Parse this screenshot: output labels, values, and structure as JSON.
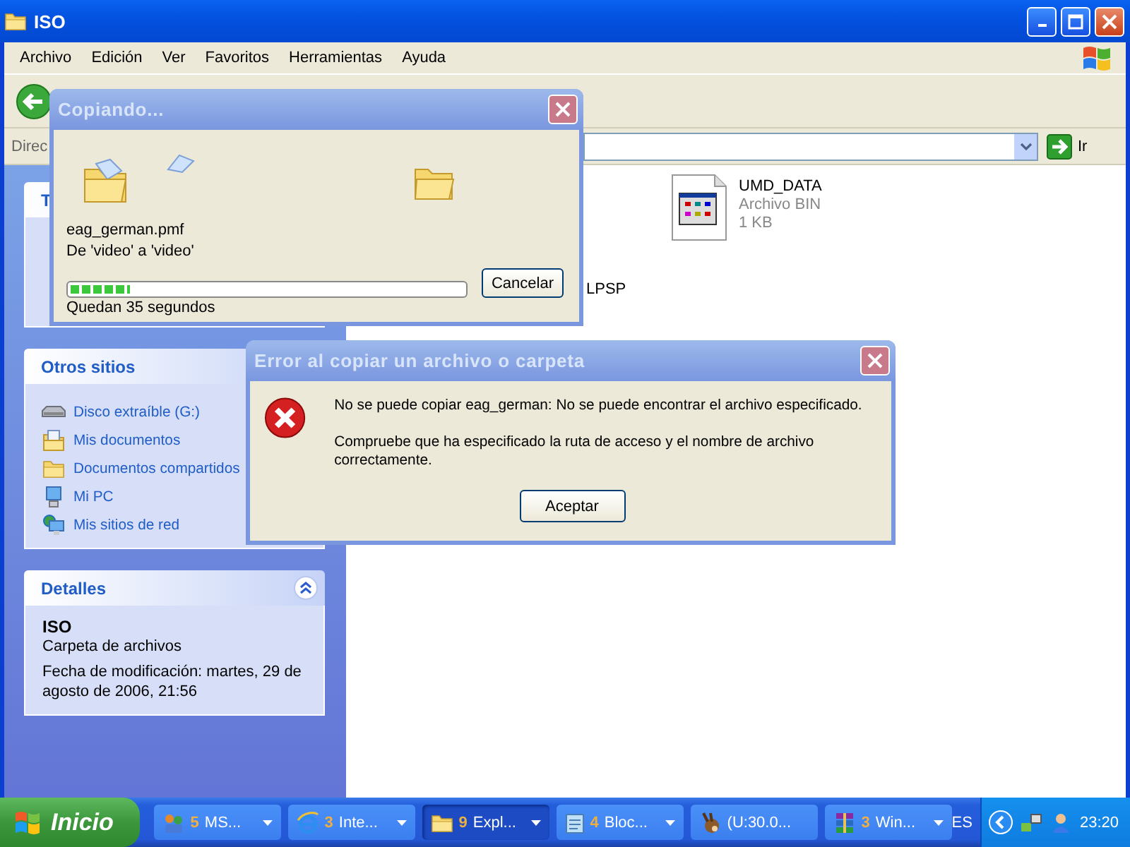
{
  "window": {
    "title": "ISO"
  },
  "menu": [
    "Archivo",
    "Edición",
    "Ver",
    "Favoritos",
    "Herramientas",
    "Ayuda"
  ],
  "address_bar": {
    "label": "Direc",
    "go_label": "Ir"
  },
  "task_panes": [
    {
      "title": "T",
      "kind": "links"
    },
    {
      "title": "Otros sitios",
      "kind": "links",
      "items": [
        {
          "label": "Disco extraíble (G:)",
          "kind": "drive"
        },
        {
          "label": "Mis documentos",
          "kind": "documents"
        },
        {
          "label": "Documentos compartidos",
          "kind": "folder"
        },
        {
          "label": "Mi PC",
          "kind": "computer"
        },
        {
          "label": "Mis sitios de red",
          "kind": "network"
        }
      ]
    },
    {
      "title": "Detalles",
      "kind": "details",
      "name": "ISO",
      "type": "Carpeta de archivos",
      "modified": "Fecha de modificación: martes, 29 de agosto de 2006, 21:56"
    }
  ],
  "files": [
    {
      "name": "UMD_DATA",
      "type": "Archivo BIN",
      "size": "1 KB",
      "kind": "bin"
    },
    {
      "name": "LPSP",
      "kind": "hidden-icon"
    }
  ],
  "copy_dialog": {
    "title": "Copiando...",
    "file": "eag_german.pmf",
    "route": "De 'video' a 'video'",
    "progress": {
      "level": 0.15
    },
    "remaining": "Quedan 35 segundos",
    "button": "Cancelar"
  },
  "error_dialog": {
    "title": "Error al copiar un archivo o carpeta",
    "message": "No se puede copiar eag_german: No se puede encontrar el archivo especificado.",
    "hint": "Compruebe que ha especificado la ruta de acceso y el nombre de archivo correctamente.",
    "button": "Aceptar"
  },
  "taskbar": {
    "start": "Inicio",
    "tasks": [
      {
        "count": "5",
        "label": "MS...",
        "kind": "people",
        "grouped": true,
        "selected": false
      },
      {
        "count": "3",
        "label": "Inte...",
        "kind": "browser",
        "grouped": true,
        "selected": false
      },
      {
        "count": "9",
        "label": "Expl...",
        "kind": "folder",
        "grouped": true,
        "selected": true
      },
      {
        "count": "4",
        "label": "Bloc...",
        "kind": "notepad",
        "grouped": true,
        "selected": false
      },
      {
        "label": "(U:30.0...",
        "kind": "mule",
        "grouped": false,
        "selected": false
      },
      {
        "count": "3",
        "label": "Win...",
        "kind": "archive",
        "grouped": true,
        "selected": false
      }
    ],
    "language": "ES",
    "clock": "23:20"
  }
}
